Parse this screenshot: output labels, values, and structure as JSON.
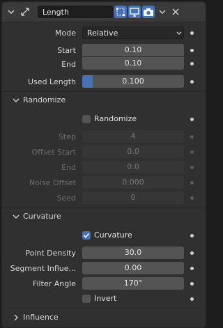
{
  "modifier": {
    "name": "Length",
    "mode_label": "Mode",
    "mode_value": "Relative",
    "start_label": "Start",
    "start_value": "0.10",
    "end_label": "End",
    "end_value": "0.10",
    "used_length_label": "Used Length",
    "used_length_value": "0.100",
    "used_length_fraction": 0.1
  },
  "randomize": {
    "title": "Randomize",
    "checkbox_label": "Randomize",
    "checked": false,
    "step_label": "Step",
    "step_value": "4",
    "offset_start_label": "Offset Start",
    "offset_start_value": "0.0",
    "end_label": "End",
    "end_value": "0.0",
    "noise_offset_label": "Noise Offset",
    "noise_offset_value": "0.000",
    "seed_label": "Seed",
    "seed_value": "0"
  },
  "curvature": {
    "title": "Curvature",
    "checkbox_label": "Curvature",
    "checked": true,
    "point_density_label": "Point Density",
    "point_density_value": "30.0",
    "segment_influence_label": "Segment Influe...",
    "segment_influence_value": "0.00",
    "filter_angle_label": "Filter Angle",
    "filter_angle_value": "170°",
    "invert_label": "Invert",
    "invert_checked": false
  },
  "influence": {
    "title": "Influence"
  },
  "colors": {
    "accent": "#4772b3",
    "panel": "#303030",
    "field": "#545454"
  },
  "icons": [
    "chevron-down-icon",
    "length-arrows-icon",
    "edit-mode-icon",
    "viewport-icon",
    "camera-icon",
    "close-icon"
  ]
}
